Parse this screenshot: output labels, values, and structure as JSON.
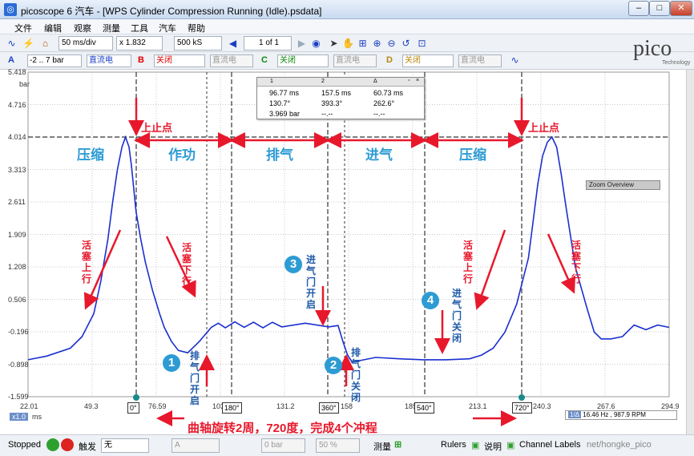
{
  "window": {
    "title": "picoscope 6 汽车 - [WPS Cylinder Compression Running (Idle).psdata]",
    "app_icon": "pico-app-icon"
  },
  "menu": [
    "文件",
    "编辑",
    "观察",
    "测量",
    "工具",
    "汽车",
    "帮助"
  ],
  "toolbar": {
    "timebase": "50 ms/div",
    "zoom": "x 1.832",
    "samples": "500 kS",
    "page": "1 of 1"
  },
  "channels": {
    "a": {
      "letter": "A",
      "range": "-2 .. 7 bar",
      "coupling": "直流电"
    },
    "b": {
      "letter": "B",
      "state": "关闭",
      "coupling": "直流电"
    },
    "c": {
      "letter": "C",
      "state": "关闭",
      "coupling": "直流电"
    },
    "d": {
      "letter": "D",
      "state": "关闭",
      "coupling": "直流电"
    }
  },
  "brand": {
    "logo_text": "pico",
    "sub": "Technology"
  },
  "plot": {
    "y_unit": "bar",
    "y_ticks": [
      "5.418",
      "4.716",
      "4.014",
      "3.313",
      "2.611",
      "1.909",
      "1.208",
      "0.506",
      "-0.196",
      "-0.898",
      "-1.599"
    ],
    "x_ticks": [
      "22.01",
      "49.3",
      "76.59",
      "103",
      "131.2",
      "158",
      "185",
      "213.1",
      "240.3",
      "267.6",
      "294.9"
    ],
    "x_unit": "ms",
    "x_scale": "x1.0",
    "angles": [
      "0°",
      "180°",
      "360°",
      "540°",
      "720°"
    ],
    "stroke_labels": [
      "压缩",
      "作功",
      "排气",
      "进气",
      "压缩"
    ],
    "tdc_label": "上止点",
    "piston_up": "活塞上行",
    "piston_down": "活塞下行",
    "exhaust_open": "排气门开启",
    "intake_open": "进气门开启",
    "exhaust_close": "排气门关闭",
    "intake_close": "进气门关闭",
    "markers": [
      "1",
      "2",
      "3",
      "4"
    ],
    "bottom_caption": "曲轴旋转2周，720度，完成4个冲程",
    "zoom_overview": "Zoom Overview",
    "rpm_info": "16.46 Hz , 987.9 RPM",
    "rpm_prefix": "1/Δ"
  },
  "measurements": {
    "headers": [
      "1",
      "2",
      "Δ"
    ],
    "rows": [
      [
        "96.77 ms",
        "157.5 ms",
        "60.73 ms"
      ],
      [
        "130.7°",
        "393.3°",
        "262.6°"
      ],
      [
        "3.969 bar",
        "--.--",
        "--.--"
      ]
    ]
  },
  "status": {
    "state": "Stopped",
    "trigger_label": "触发",
    "trigger_value": "无",
    "channel_value": "A",
    "level": "0 bar",
    "percent": "50 %",
    "measure_label": "测量",
    "rulers_label": "Rulers",
    "notes_label": "说明",
    "channel_labels": "Channel Labels",
    "watermark": "net/hongke_pico"
  },
  "chart_data": {
    "type": "line",
    "title": "",
    "xlabel": "ms",
    "ylabel": "bar",
    "xlim": [
      22.01,
      294.9
    ],
    "ylim": [
      -1.599,
      5.418
    ],
    "series": [
      {
        "x": [
          22.01,
          30,
          40,
          45,
          50,
          53,
          56,
          58,
          60,
          62,
          63.5,
          65,
          66,
          67,
          68,
          70,
          72,
          75,
          78,
          80,
          83,
          86,
          90,
          95,
          100,
          103,
          106,
          110,
          114,
          118,
          122,
          126,
          130,
          140,
          150,
          154,
          156,
          158,
          160,
          165,
          170,
          180,
          190,
          200,
          210,
          215,
          220,
          225,
          230,
          235,
          237,
          239,
          241,
          243,
          245,
          247,
          249,
          251,
          255,
          260,
          263,
          266,
          270,
          275,
          280,
          285,
          290,
          294.9
        ],
        "y": [
          -0.8,
          -0.72,
          -0.55,
          -0.3,
          0.2,
          0.9,
          1.8,
          2.6,
          3.3,
          3.8,
          4.014,
          3.8,
          3.4,
          2.9,
          2.4,
          1.8,
          1.3,
          0.7,
          0.2,
          -0.1,
          -0.4,
          -0.6,
          -0.65,
          -0.4,
          -0.1,
          -0.05,
          -0.07,
          -0.02,
          -0.06,
          -0.03,
          -0.07,
          -0.03,
          -0.05,
          -0.05,
          -0.05,
          -0.1,
          -0.4,
          -0.7,
          -0.85,
          -0.8,
          -0.75,
          -0.78,
          -0.8,
          -0.8,
          -0.78,
          -0.7,
          -0.55,
          -0.2,
          0.4,
          1.4,
          2.2,
          3.0,
          3.6,
          3.9,
          4.014,
          3.8,
          3.2,
          2.5,
          1.2,
          0.3,
          -0.2,
          -0.35,
          -0.35,
          -0.3,
          -0.05,
          -0.15,
          -0.05,
          -0.1
        ]
      }
    ]
  }
}
